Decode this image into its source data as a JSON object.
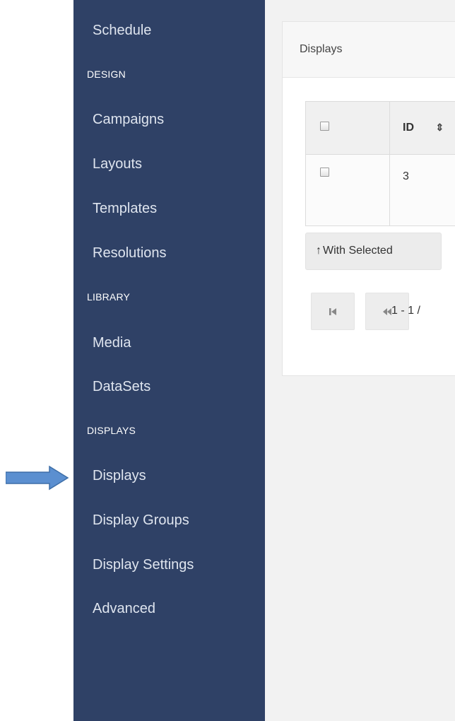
{
  "sidebar": {
    "items": [
      {
        "label": "Schedule",
        "type": "item"
      },
      {
        "label": "DESIGN",
        "type": "header"
      },
      {
        "label": "Campaigns",
        "type": "item"
      },
      {
        "label": "Layouts",
        "type": "item"
      },
      {
        "label": "Templates",
        "type": "item"
      },
      {
        "label": "Resolutions",
        "type": "item"
      },
      {
        "label": "LIBRARY",
        "type": "header"
      },
      {
        "label": "Media",
        "type": "item"
      },
      {
        "label": "DataSets",
        "type": "item"
      },
      {
        "label": "DISPLAYS",
        "type": "header"
      },
      {
        "label": "Displays",
        "type": "item",
        "active": true
      },
      {
        "label": "Display Groups",
        "type": "item"
      },
      {
        "label": "Display Settings",
        "type": "item"
      },
      {
        "label": "Advanced",
        "type": "item"
      }
    ],
    "background": "#2f4166"
  },
  "annotation": {
    "pointer": "right-arrow-icon",
    "color": "#5b8fd0"
  },
  "main": {
    "panel_title": "Displays",
    "table": {
      "columns": [
        "",
        "ID"
      ],
      "rows": [
        {
          "id": "3"
        }
      ]
    },
    "with_selected_label": "With Selected",
    "pager": {
      "info": "1 - 1 /",
      "first_icon": "first-page-icon",
      "prev_icon": "previous-page-icon"
    }
  }
}
